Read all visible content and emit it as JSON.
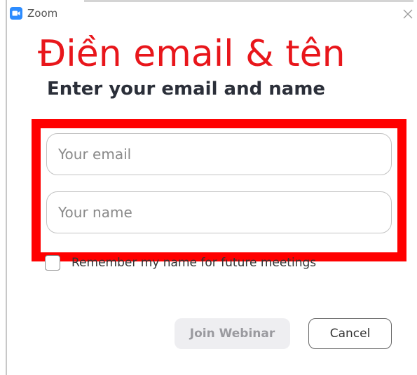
{
  "window": {
    "title": "Zoom",
    "close_icon": "close-icon",
    "logo_icon": "zoom-camera-icon"
  },
  "annotation": {
    "caption": "Điền email & tên",
    "color": "#e8161b",
    "highlight_color": "#ff0000"
  },
  "form": {
    "heading": "Enter your email and name",
    "email": {
      "value": "",
      "placeholder": "Your email"
    },
    "name": {
      "value": "",
      "placeholder": "Your name"
    },
    "remember": {
      "label": "Remember my name for future meetings",
      "checked": false
    }
  },
  "buttons": {
    "join_label": "Join Webinar",
    "cancel_label": "Cancel"
  },
  "colors": {
    "zoom_blue": "#2d8cff",
    "heading": "#2b2f39",
    "disabled_bg": "#eeeef1"
  }
}
